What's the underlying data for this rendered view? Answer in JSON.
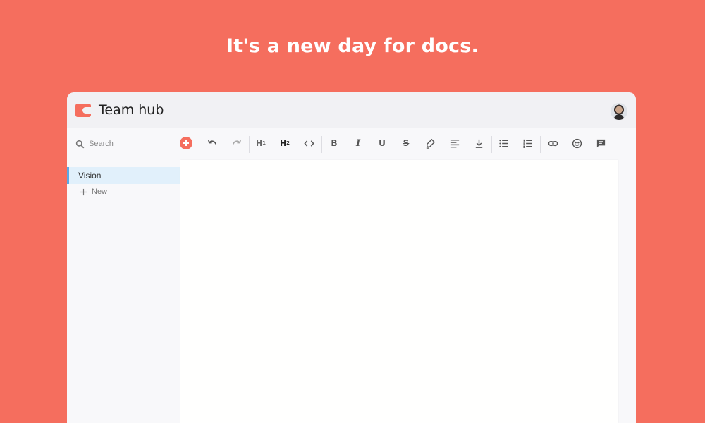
{
  "headline": "It's a new day for docs.",
  "app": {
    "title": "Team hub",
    "avatar": "user-avatar",
    "brand_color": "#F56E5E"
  },
  "search": {
    "label": "Search",
    "icon": "search-icon"
  },
  "toolbar": {
    "add_icon": "plus-icon",
    "undo_icon": "undo-icon",
    "redo_icon": "redo-icon",
    "h1_label": "H",
    "h1_sub": "1",
    "h2_label": "H",
    "h2_sub": "2",
    "code_icon": "code-icon",
    "bold_label": "B",
    "italic_label": "I",
    "underline_label": "U",
    "strike_label": "S",
    "highlight_icon": "highlighter-icon",
    "align_icon": "align-left-icon",
    "download_icon": "download-icon",
    "bullet_list_icon": "bullet-list-icon",
    "numbered_list_icon": "numbered-list-icon",
    "link_icon": "link-icon",
    "emoji_icon": "emoji-icon",
    "comment_icon": "comment-icon"
  },
  "sidebar": {
    "items": [
      {
        "label": "Vision",
        "active": true
      }
    ],
    "new_label": "New",
    "accent": "#5AA9E6"
  }
}
